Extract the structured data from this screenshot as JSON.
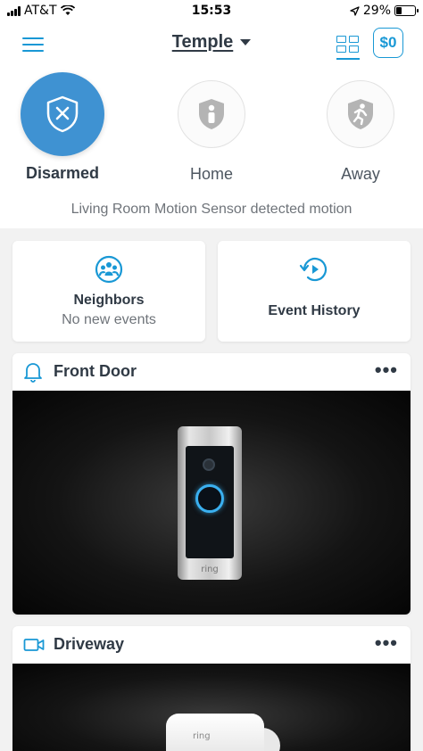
{
  "status_bar": {
    "carrier": "AT&T",
    "time": "15:53",
    "battery_percent": "29%",
    "battery_level": 0.29
  },
  "header": {
    "location": "Temple",
    "balance_label": "$0"
  },
  "modes": {
    "items": [
      {
        "label": "Disarmed",
        "icon": "shield-x-icon",
        "active": true
      },
      {
        "label": "Home",
        "icon": "shield-person-icon",
        "active": false
      },
      {
        "label": "Away",
        "icon": "shield-running-icon",
        "active": false
      }
    ],
    "status_text": "Living Room Motion Sensor detected motion"
  },
  "tiles": {
    "neighbors": {
      "title": "Neighbors",
      "subtitle": "No new events",
      "icon": "neighbors-icon"
    },
    "event_history": {
      "title": "Event History",
      "icon": "history-play-icon"
    }
  },
  "devices": [
    {
      "name": "Front Door",
      "icon": "bell-icon",
      "brand_text": "ring"
    },
    {
      "name": "Driveway",
      "icon": "video-camera-icon",
      "brand_text": "ring"
    }
  ],
  "colors": {
    "accent": "#1998d5",
    "mode_active": "#3f92d2",
    "text_dark": "#303a45",
    "text_muted": "#6f747a"
  }
}
